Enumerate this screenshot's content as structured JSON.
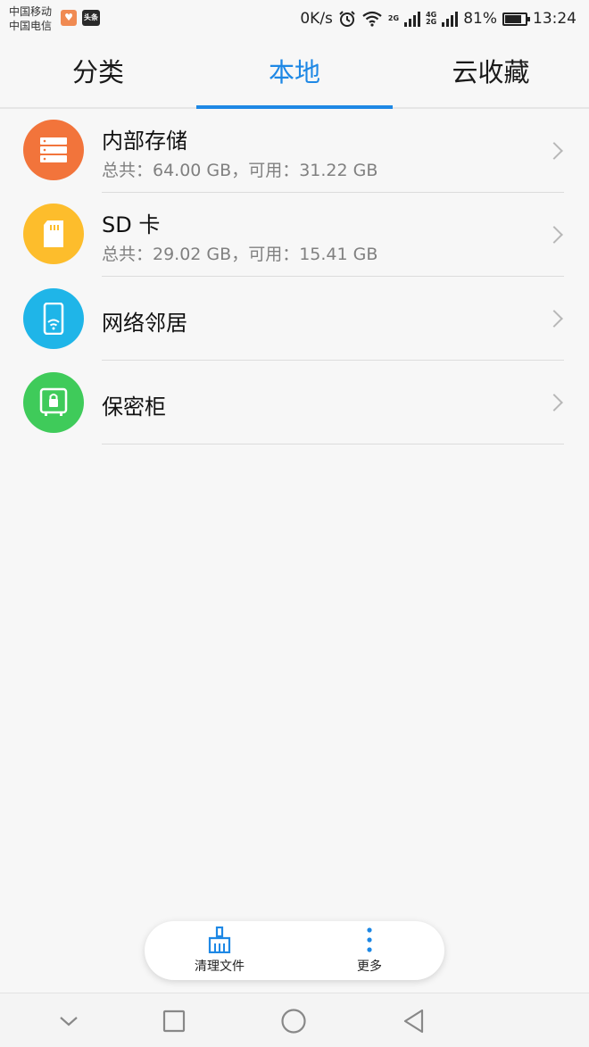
{
  "status_bar": {
    "carrier_1": "中国移动",
    "carrier_2": "中国电信",
    "news_badge": "头条",
    "speed": "0K/s",
    "net_2g": "2G",
    "net_4g": "4G",
    "net_2g_b": "2G",
    "battery_text": "81%",
    "battery_level": 0.81,
    "time": "13:24"
  },
  "tabs": [
    {
      "label": "分类"
    },
    {
      "label": "本地"
    },
    {
      "label": "云收藏"
    }
  ],
  "active_tab": "本地",
  "list": [
    {
      "title": "内部存储",
      "subtitle": "总共：64.00 GB，可用：31.22 GB",
      "icon": "server-storage-icon",
      "color": "#f2743b"
    },
    {
      "title": "SD 卡",
      "subtitle": "总共：29.02 GB，可用：15.41 GB",
      "icon": "sd-card-icon",
      "color": "#fdbd2c"
    },
    {
      "title": "网络邻居",
      "subtitle": "",
      "icon": "network-phone-icon",
      "color": "#1fb5e8"
    },
    {
      "title": "保密柜",
      "subtitle": "",
      "icon": "safe-lock-icon",
      "color": "#3fcb5a"
    }
  ],
  "toolbar": {
    "clean_label": "清理文件",
    "more_label": "更多",
    "accent": "#1e88e5"
  }
}
